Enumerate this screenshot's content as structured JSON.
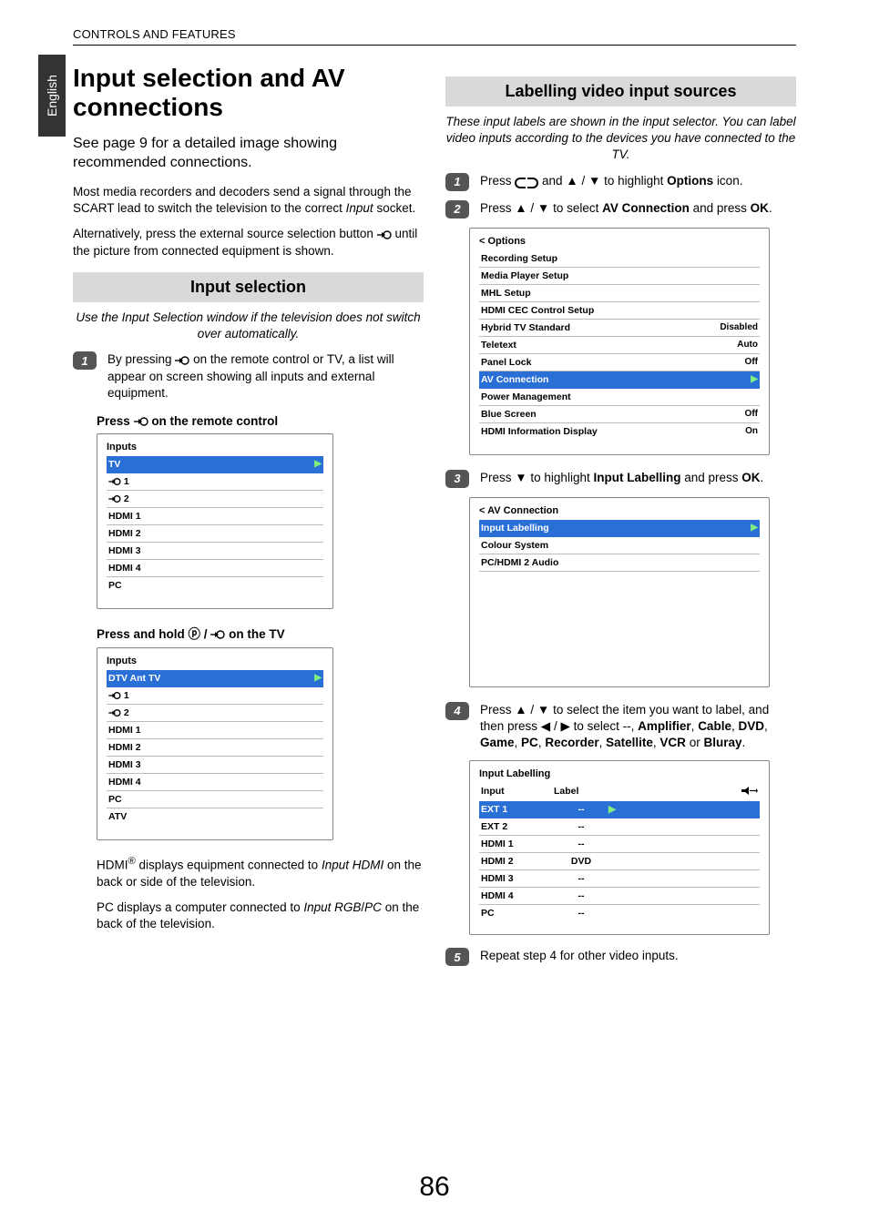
{
  "language_tab": "English",
  "breadcrumb": "CONTROLS AND FEATURES",
  "page_number": "86",
  "left": {
    "title": "Input selection and AV connections",
    "intro": "See page 9 for a detailed image showing recommended connections.",
    "para1_a": "Most media recorders and decoders send a signal through the SCART lead to switch the television to the correct ",
    "para1_b": "Input",
    "para1_c": " socket.",
    "para2_a": "Alternatively, press the external source selection button ",
    "para2_b": " until the picture from connected equipment is shown.",
    "section1_title": "Input selection",
    "section1_intro": "Use the Input Selection window if the television does not switch over automatically.",
    "step1_a": "By pressing ",
    "step1_b": " on the remote control or TV, a list will appear on screen showing all inputs and external equipment.",
    "sub1_a": "Press ",
    "sub1_b": " on the remote control",
    "inputs_menu_title": "Inputs",
    "inputs1": [
      "TV",
      "1",
      "2",
      "HDMI 1",
      "HDMI 2",
      "HDMI 3",
      "HDMI 4",
      "PC"
    ],
    "sub2_a": "Press and hold ",
    "sub2_b": " / ",
    "sub2_c": " on the TV",
    "inputs2": [
      "DTV Ant TV",
      "1",
      "2",
      "HDMI 1",
      "HDMI 2",
      "HDMI 3",
      "HDMI 4",
      "PC",
      "ATV"
    ],
    "foot1_a": "HDMI",
    "foot1_sup": "®",
    "foot1_b": " displays equipment connected to ",
    "foot1_c": "Input HDMI",
    "foot1_d": " on the back or side of the television.",
    "foot2_a": "PC displays a computer connected to ",
    "foot2_b": "Input RGB",
    "foot2_c": "/",
    "foot2_d": "PC",
    "foot2_e": " on the back of the television."
  },
  "right": {
    "section_title": "Labelling video input sources",
    "intro": "These input labels are shown in the input selector. You can label video inputs according to the devices you have connected to the TV.",
    "step1_a": "Press ",
    "step1_b": " and ",
    "step1_c": " / ",
    "step1_d": " to highlight ",
    "step1_e": "Options",
    "step1_f": " icon.",
    "step2_a": "Press ",
    "step2_b": " / ",
    "step2_c": " to select ",
    "step2_d": "AV Connection",
    "step2_e": " and press ",
    "step2_f": "OK",
    "step2_g": ".",
    "options_title": "< Options",
    "options_items": [
      {
        "label": "Recording Setup",
        "val": ""
      },
      {
        "label": "Media Player Setup",
        "val": ""
      },
      {
        "label": "MHL Setup",
        "val": ""
      },
      {
        "label": "HDMI CEC Control Setup",
        "val": ""
      },
      {
        "label": "Hybrid TV Standard",
        "val": "Disabled"
      },
      {
        "label": "Teletext",
        "val": "Auto"
      },
      {
        "label": "Panel Lock",
        "val": "Off"
      },
      {
        "label": "AV Connection",
        "val": "",
        "sel": true,
        "play": true
      },
      {
        "label": "Power Management",
        "val": ""
      },
      {
        "label": "Blue Screen",
        "val": "Off"
      },
      {
        "label": "HDMI Information Display",
        "val": "On"
      }
    ],
    "step3_a": "Press ",
    "step3_b": " to highlight ",
    "step3_c": "Input Labelling",
    "step3_d": " and press ",
    "step3_e": "OK",
    "step3_f": ".",
    "avc_title": "< AV Connection",
    "avc_items": [
      {
        "label": "Input Labelling",
        "sel": true,
        "play": true
      },
      {
        "label": "Colour System"
      },
      {
        "label": "PC/HDMI 2 Audio"
      }
    ],
    "step4_a": "Press ",
    "step4_b": " / ",
    "step4_c": " to select the item you want to label, and then press ",
    "step4_d": " / ",
    "step4_e": " to select --, ",
    "step4_f": "Amplifier",
    "step4_g": ", ",
    "step4_h": "Cable",
    "step4_i": ", ",
    "step4_j": "DVD",
    "step4_k": ", ",
    "step4_l": "Game",
    "step4_m": ", ",
    "step4_n": "PC",
    "step4_o": ", ",
    "step4_p": "Recorder",
    "step4_q": ", ",
    "step4_r": "Satellite",
    "step4_s": ", ",
    "step4_t": "VCR",
    "step4_u": " or ",
    "step4_v": "Bluray",
    "step4_w": ".",
    "il_title": "Input Labelling",
    "il_head_input": "Input",
    "il_head_label": "Label",
    "il_rows": [
      {
        "input": "EXT 1",
        "label": "--",
        "sel": true,
        "play": true
      },
      {
        "input": "EXT 2",
        "label": "--"
      },
      {
        "input": "HDMI 1",
        "label": "--"
      },
      {
        "input": "HDMI 2",
        "label": "DVD"
      },
      {
        "input": "HDMI 3",
        "label": "--"
      },
      {
        "input": "HDMI 4",
        "label": "--"
      },
      {
        "input": "PC",
        "label": "--"
      }
    ],
    "step5": "Repeat step 4 for other video inputs."
  },
  "glyphs": {
    "up": "▲",
    "down": "▼",
    "left": "◀",
    "right": "▶",
    "p_circ": "ⓟ"
  }
}
